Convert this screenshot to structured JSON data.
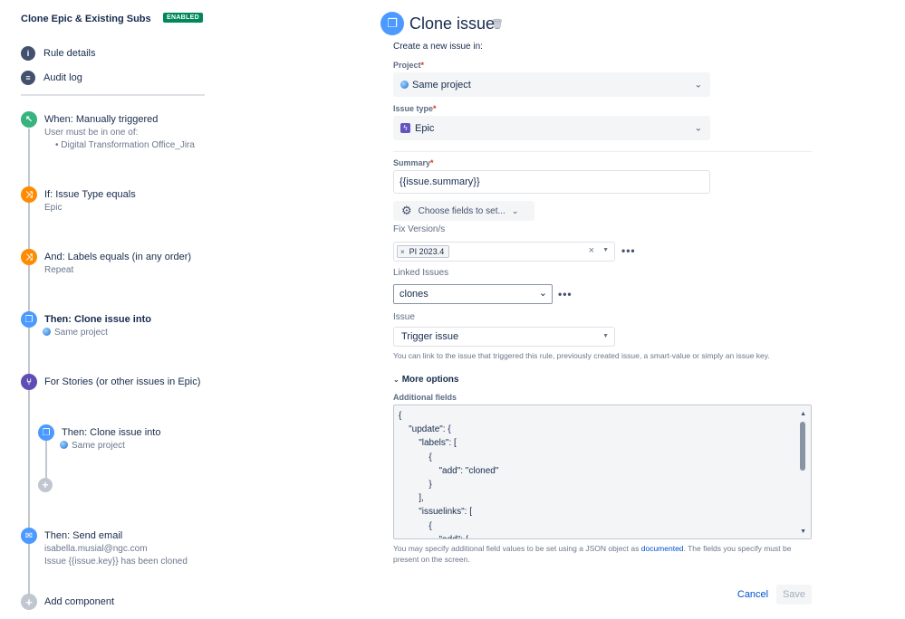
{
  "rule": {
    "title": "Clone Epic & Existing Subs",
    "status": "ENABLED"
  },
  "nav": [
    {
      "label": "Rule details",
      "icon": "info-icon"
    },
    {
      "label": "Audit log",
      "icon": "list-icon"
    }
  ],
  "steps": {
    "trigger": {
      "title": "When: Manually triggered",
      "sub1": "User must be in one of:",
      "sub2": "Digital Transformation Office_Jira"
    },
    "cond1": {
      "title": "If: Issue Type equals",
      "sub": "Epic"
    },
    "cond2": {
      "title": "And: Labels equals (in any order)",
      "sub": "Repeat"
    },
    "clone": {
      "title": "Then: Clone issue into",
      "sub": "Same project"
    },
    "branch": {
      "title": "For Stories (or other issues in Epic)"
    },
    "clone2": {
      "title": "Then: Clone issue into",
      "sub": "Same project"
    },
    "email": {
      "title": "Then: Send email",
      "sub1": "isabella.musial@ngc.com",
      "sub2": "Issue {{issue.key}} has been cloned"
    },
    "add": {
      "label": "Add component"
    }
  },
  "form": {
    "heading": "Clone issue",
    "create_in": "Create a new issue in:",
    "project_label": "Project",
    "project_value": "Same project",
    "issue_type_label": "Issue type",
    "issue_type_value": "Epic",
    "summary_label": "Summary",
    "summary_value": "{{issue.summary}}",
    "choose_fields": "Choose fields to set...",
    "fix_version_label": "Fix Version/s",
    "fix_version_tag": "PI 2023.4",
    "linked_label": "Linked Issues",
    "linked_value": "clones",
    "issue_label": "Issue",
    "issue_value": "Trigger issue",
    "issue_help": "You can link to the issue that triggered this rule, previously created issue, a smart-value or simply an issue key.",
    "more_options": "More options",
    "additional_label": "Additional fields",
    "json_text": "{\n    \"update\": {\n        \"labels\": [\n            {\n                \"add\": \"cloned\"\n            }\n        ],\n        \"issuelinks\": [\n            {\n                \"add\": {",
    "additional_help_pre": "You may specify additional field values to be set using a JSON object as ",
    "additional_help_link": "documented",
    "additional_help_post": ". The fields you specify must be present on the screen.",
    "cancel": "Cancel",
    "save": "Save"
  },
  "colors": {
    "link": "#0052cc",
    "enabled": "#00875a",
    "trigger": "#36b37e",
    "condition": "#ff8b00",
    "action": "#4c9aff",
    "branch": "#5e4db2"
  }
}
